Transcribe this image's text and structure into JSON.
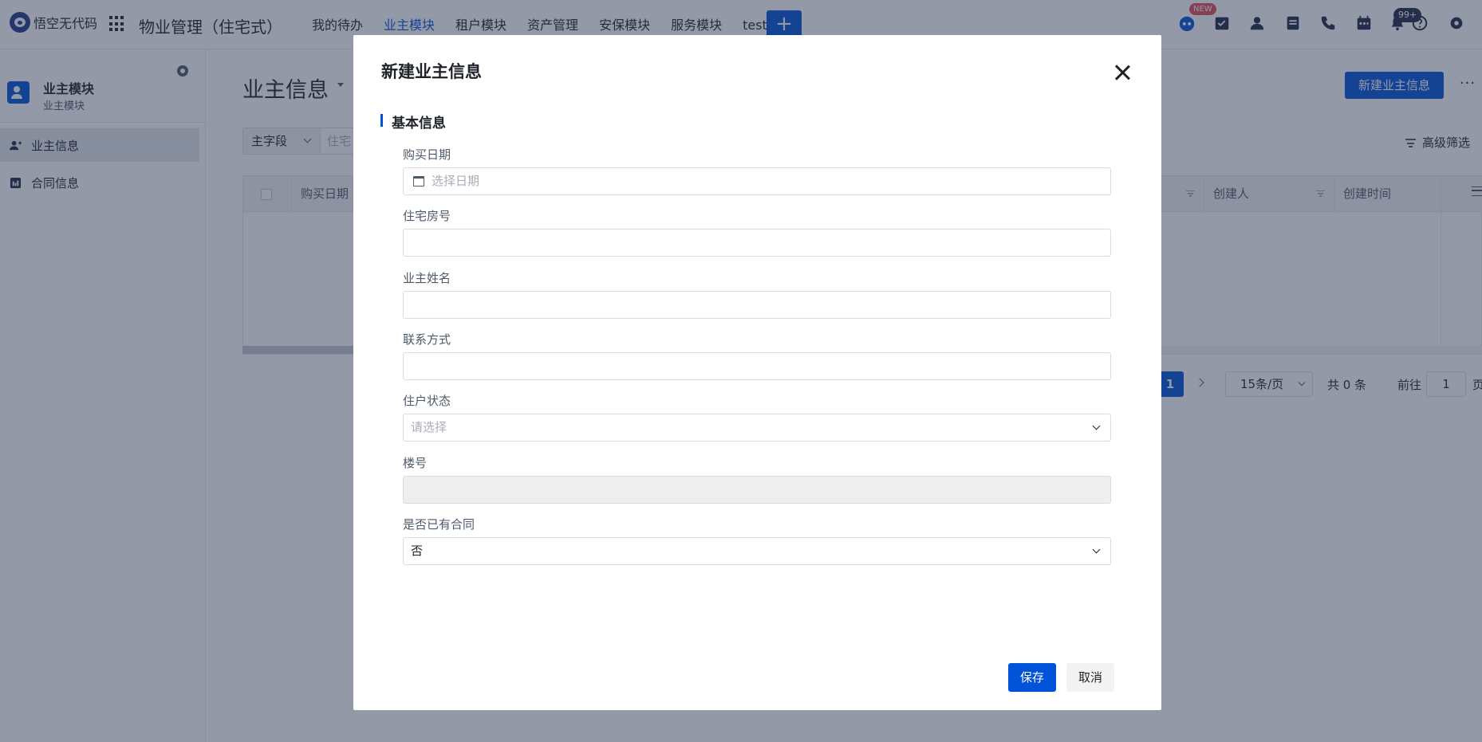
{
  "header": {
    "logo_text": "悟空无代码",
    "app_title": "物业管理（住宅式）",
    "nav": [
      {
        "label": "我的待办"
      },
      {
        "label": "业主模块"
      },
      {
        "label": "租户模块"
      },
      {
        "label": "资产管理"
      },
      {
        "label": "安保模块"
      },
      {
        "label": "服务模块"
      },
      {
        "label": "test"
      }
    ],
    "add_label": "+",
    "new_badge": "NEW",
    "notify_count": "99+"
  },
  "sidebar": {
    "module_title": "业主模块",
    "module_subtitle": "业主模块",
    "items": [
      {
        "label": "业主信息"
      },
      {
        "label": "合同信息"
      }
    ]
  },
  "main": {
    "page_title": "业主信息",
    "new_button": "新建业主信息",
    "more_button": "···",
    "field_select": "主字段",
    "search_placeholder": "住宅",
    "advanced_filter": "高级筛选",
    "columns": [
      "购买日期",
      "创建人",
      "创建时间"
    ],
    "pagination": {
      "current": "1",
      "page_size": "15条/页",
      "total": "共 0 条",
      "goto_label": "前往",
      "goto_value": "1",
      "unit": "页"
    }
  },
  "modal": {
    "title": "新建业主信息",
    "section": "基本信息",
    "fields": [
      {
        "label": "购买日期",
        "placeholder": "选择日期",
        "value": ""
      },
      {
        "label": "住宅房号",
        "placeholder": "",
        "value": ""
      },
      {
        "label": "业主姓名",
        "placeholder": "",
        "value": ""
      },
      {
        "label": "联系方式",
        "placeholder": "",
        "value": ""
      },
      {
        "label": "住户状态",
        "placeholder": "请选择",
        "value": ""
      },
      {
        "label": "楼号",
        "placeholder": "",
        "value": ""
      },
      {
        "label": "是否已有合同",
        "placeholder": "",
        "value": "否"
      }
    ],
    "save": "保存",
    "cancel": "取消"
  },
  "colors": {
    "primary": "#0052d9",
    "overlay": "rgba(40,52,80,0.5)"
  }
}
